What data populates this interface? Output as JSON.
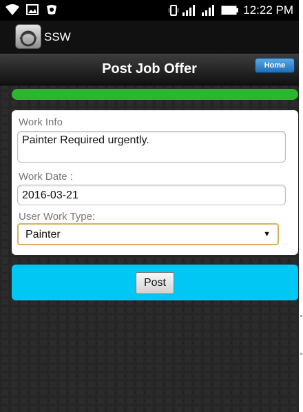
{
  "status_bar": {
    "time": "12:22 PM",
    "icons": [
      "wifi-icon",
      "image-icon",
      "app-notification-icon",
      "vibrate-icon",
      "signal-icon",
      "signal-icon",
      "battery-icon"
    ]
  },
  "app_bar": {
    "app_name": "SSW",
    "logo_icon": "app-logo-icon"
  },
  "header": {
    "title": "Post Job Offer",
    "home_label": "Home"
  },
  "progress": {
    "value_percent": 100,
    "color": "#2db52d"
  },
  "form": {
    "work_info": {
      "label": "Work Info",
      "value": "Painter Required urgently."
    },
    "work_date": {
      "label": "Work Date :",
      "value": "2016-03-21"
    },
    "user_work_type": {
      "label": "User Work Type:",
      "selected": "Painter"
    }
  },
  "actions": {
    "post_label": "Post",
    "panel_color": "#00c7f4"
  }
}
